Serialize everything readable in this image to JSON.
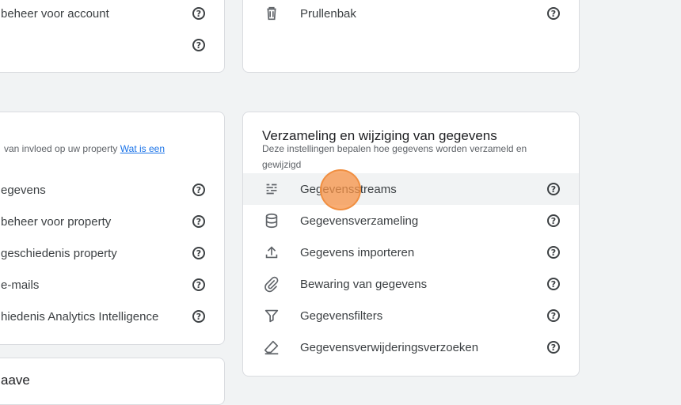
{
  "top_left_card": {
    "items": [
      {
        "label": "beheer voor account",
        "icon": "help-icon"
      },
      {
        "label": "",
        "icon": "help-icon"
      }
    ]
  },
  "top_right_card": {
    "items": [
      {
        "label": "Prullenbak",
        "icon": "trash-icon"
      }
    ]
  },
  "property_card": {
    "subtitle_text": "van invloed op uw property",
    "subtitle_link": "Wat is een",
    "items": [
      {
        "label": "egevens"
      },
      {
        "label": "beheer voor property"
      },
      {
        "label": "geschiedenis property"
      },
      {
        "label": "e-mails"
      },
      {
        "label": "hiedenis Analytics Intelligence"
      }
    ]
  },
  "data_card": {
    "title": "Verzameling en wijziging van gegevens",
    "subtitle": "Deze instellingen bepalen hoe gegevens worden verzameld en gewijzigd",
    "items": [
      {
        "label": "Gegevensstreams",
        "icon": "data-streams-icon",
        "highlighted": true
      },
      {
        "label": "Gegevensverzameling",
        "icon": "database-icon"
      },
      {
        "label": "Gegevens importeren",
        "icon": "upload-icon"
      },
      {
        "label": "Bewaring van gegevens",
        "icon": "attachment-icon"
      },
      {
        "label": "Gegevensfilters",
        "icon": "filter-icon"
      },
      {
        "label": "Gegevensverwijderingsverzoeken",
        "icon": "eraser-icon"
      }
    ]
  },
  "bottom_card": {
    "title_fragment": "aave"
  },
  "colors": {
    "background": "#f1f3f4",
    "card": "#ffffff",
    "link": "#1a73e8",
    "highlight": "#f1f3f4",
    "cursor": "#f59146"
  }
}
